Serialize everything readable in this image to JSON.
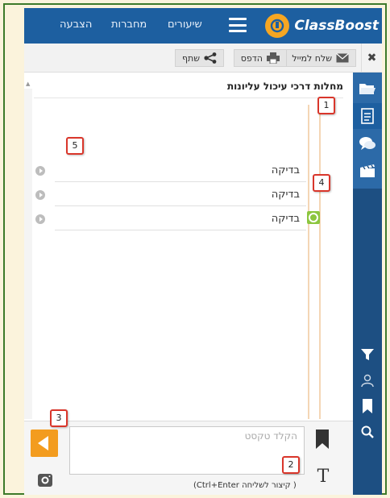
{
  "brand": {
    "name": "ClassBoost"
  },
  "nav": {
    "items": [
      "שיעורים",
      "מחברות",
      "הצבעה"
    ]
  },
  "toolbar": {
    "email_label": "שלח למייל",
    "print_label": "הדפס",
    "share_label": "שתף",
    "close_glyph": "✖"
  },
  "section": {
    "title": "מחלות דרכי עיכול עליונות"
  },
  "list": {
    "items": [
      "בדיקה",
      "בדיקה",
      "בדיקה"
    ]
  },
  "composer": {
    "placeholder": "הקלד טקסט",
    "hint": "( קיצור לשליחה Ctrl+Enter)",
    "text_tool": "T"
  },
  "callouts": [
    "1",
    "2",
    "3",
    "4",
    "5"
  ],
  "colors": {
    "nav_bg": "#1d5fa0",
    "sidebar_bg": "#1d4f82",
    "accent_orange": "#f39c1f",
    "callout_red": "#d9362b",
    "badge_green": "#8cc63f"
  },
  "icons": {
    "sidebar_top": [
      "folder-icon",
      "document-icon",
      "chat-icon",
      "clapperboard-icon"
    ],
    "sidebar_bottom": [
      "filter-icon",
      "user-icon",
      "bookmark-icon",
      "search-icon"
    ]
  }
}
